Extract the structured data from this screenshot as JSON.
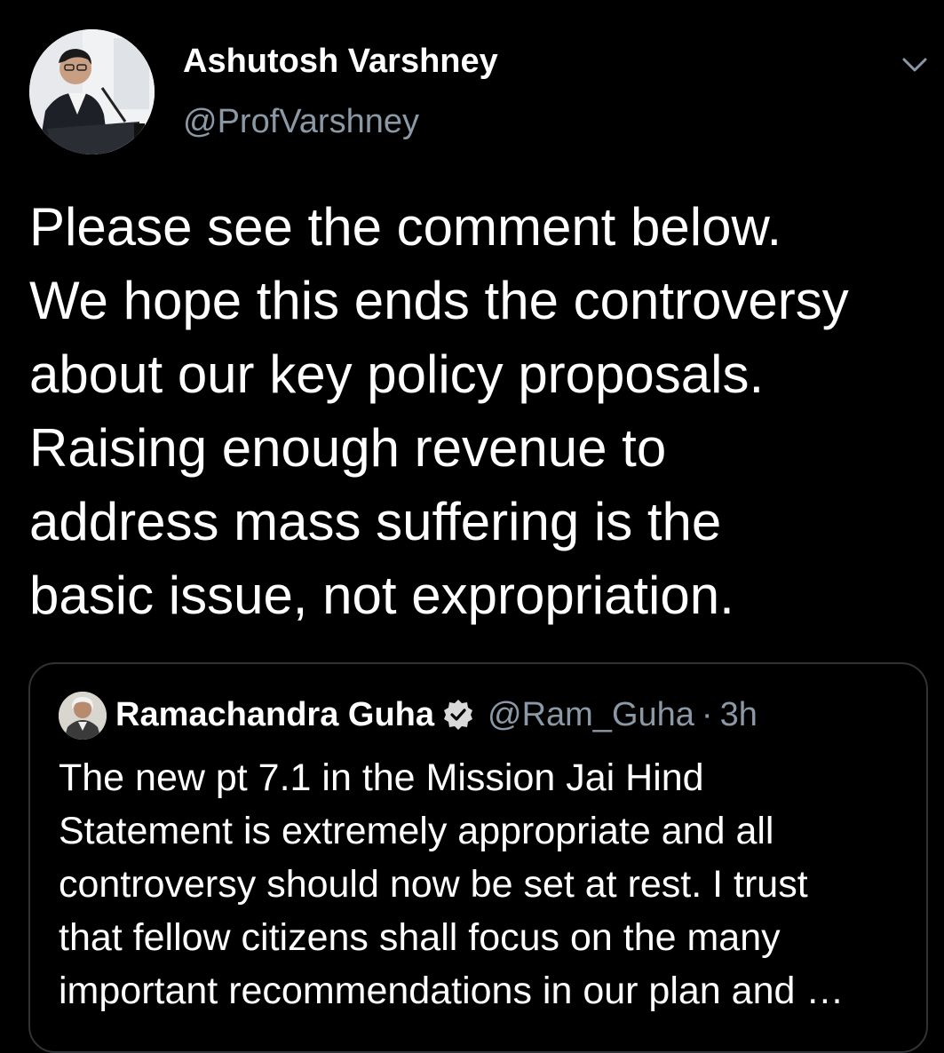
{
  "tweet": {
    "author": {
      "name": "Ashutosh Varshney",
      "handle": "@ProfVarshney",
      "avatar_icon": "profile-photo-speaker-at-podium"
    },
    "menu_icon": "chevron-down-icon",
    "text_lines": [
      "Please see the comment below.",
      "We hope this ends the controversy",
      "about our key policy proposals.",
      "Raising enough revenue to",
      "address mass suffering is the",
      "basic issue, not expropriation."
    ]
  },
  "quoted_tweet": {
    "author": {
      "name": "Ramachandra Guha",
      "handle": "@Ram_Guha",
      "verified": true,
      "avatar_icon": "profile-photo"
    },
    "separator": "·",
    "time": "3h",
    "text_lines": [
      "The new pt 7.1 in the Mission Jai Hind",
      "Statement is extremely appropriate and all",
      "controversy should now be set at rest. I trust",
      "that fellow citizens shall focus on the many",
      "important recommendations in our plan and …"
    ]
  },
  "colors": {
    "background": "#000000",
    "text_primary": "#ffffff",
    "text_secondary": "#8b98a5",
    "card_border": "#2f3336",
    "verified_badge": "#d9d9d9"
  }
}
